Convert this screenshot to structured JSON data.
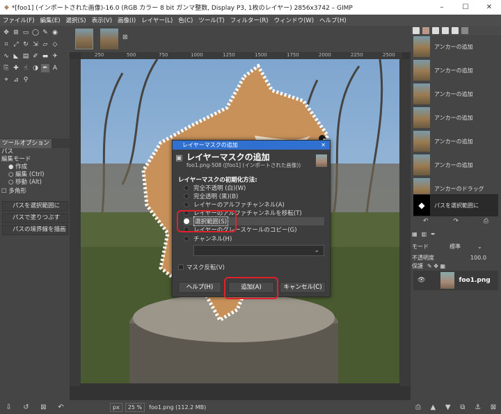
{
  "window": {
    "title": "*[foo1] (インポートされた画像)-16.0 (RGB カラー 8 bit ガンマ整数, Display P3, 1枚のレイヤー) 2856x3742 – GIMP",
    "minimize": "–",
    "maximize": "☐",
    "close": "✕"
  },
  "menu": [
    "ファイル(F)",
    "編集(E)",
    "選択(S)",
    "表示(V)",
    "画像(I)",
    "レイヤー(L)",
    "色(C)",
    "ツール(T)",
    "フィルター(R)",
    "ウィンドウ(W)",
    "ヘルプ(H)"
  ],
  "tool_options": {
    "tab": "ツールオプション",
    "title": "パス",
    "mode_label": "編集モード",
    "modes": [
      {
        "label": "作成",
        "selected": true
      },
      {
        "label": "編集 (Ctrl)",
        "selected": false
      },
      {
        "label": "移動 (Alt)",
        "selected": false
      }
    ],
    "polygon": "多角形",
    "buttons": [
      "パスを選択範囲に",
      "パスで塗りつぶす",
      "パスの境界線を描画"
    ]
  },
  "ruler": [
    "250",
    "500",
    "750",
    "1000",
    "1250",
    "1500",
    "1750",
    "2000",
    "2250",
    "2500"
  ],
  "status": {
    "unit": "px",
    "zoom": "25 %",
    "file": "foo1.png (112.2 MB)"
  },
  "undo": [
    "アンカーの追加",
    "アンカーの追加",
    "アンカーの追加",
    "アンカーの追加",
    "アンカーの追加",
    "アンカーの追加",
    "アンカーのドラッグ",
    "パスを選択範囲に"
  ],
  "layers": {
    "mode_label": "モード",
    "mode_value": "標準",
    "opacity_label": "不透明度",
    "opacity_value": "100.0",
    "lock_label": "保護",
    "layer_name": "foo1.png"
  },
  "dialog": {
    "titlebar": "レイヤーマスクの追加",
    "heading": "レイヤーマスクの追加",
    "subtitle": "foo1.png-508 ([foo1] (インポートされた画像))",
    "section": "レイヤーマスクの初期化方法:",
    "options": [
      {
        "label": "完全不透明 (白)(W)",
        "selected": false
      },
      {
        "label": "完全透明 (黒)(B)",
        "selected": false
      },
      {
        "label": "レイヤーのアルファチャンネル(A)",
        "selected": false
      },
      {
        "label": "レイヤーのアルファチャンネルを移転(T)",
        "selected": false
      },
      {
        "label": "選択範囲(S)",
        "selected": true
      },
      {
        "label": "レイヤーのグレースケールのコピー(G)",
        "selected": false
      },
      {
        "label": "チャンネル(H)",
        "selected": false
      }
    ],
    "invert": "マスク反転(V)",
    "help": "ヘルプ(H)",
    "add": "追加(A)",
    "cancel": "キャンセル(C)"
  },
  "colors": {
    "accent": "#2f70d0",
    "highlight": "#e0202a"
  }
}
